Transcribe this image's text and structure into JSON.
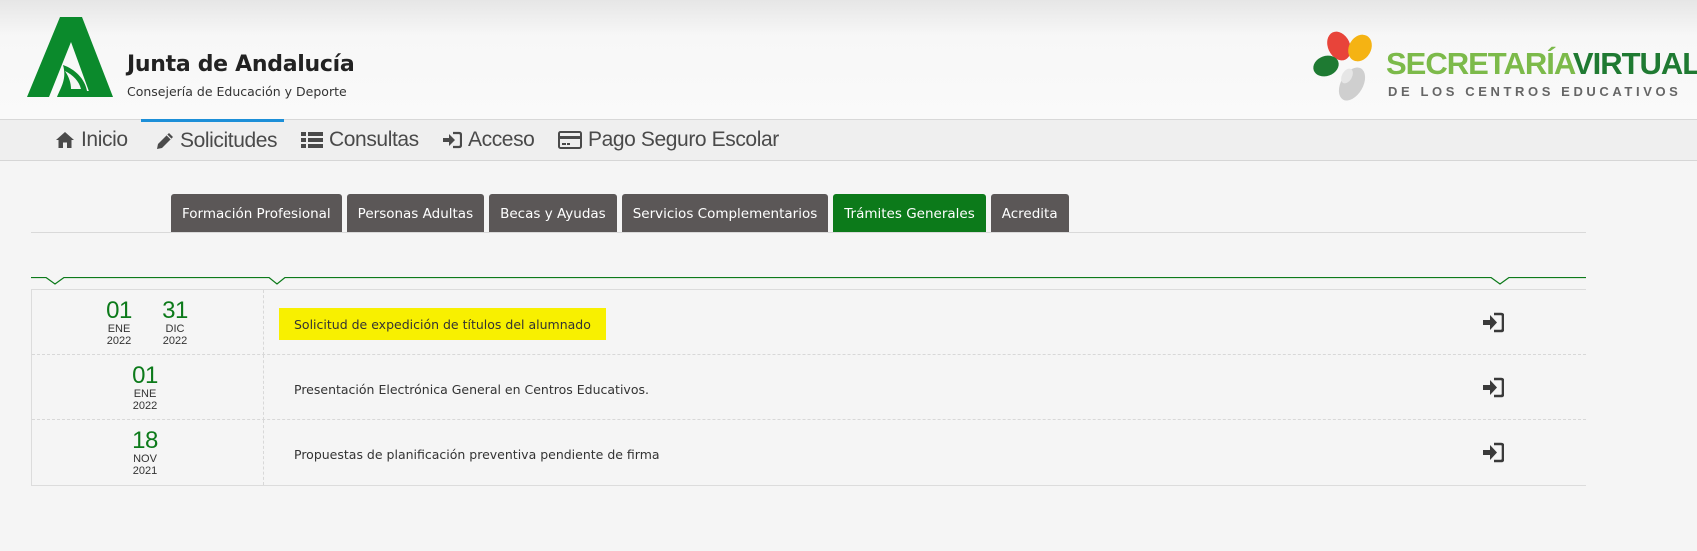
{
  "header": {
    "org_name": "Junta de Andalucía",
    "org_sub": "Consejería de Educación y Deporte",
    "sv_title_a": "SECRETARÍA",
    "sv_title_b": "VIRTUAL",
    "sv_sub": "DE LOS CENTROS EDUCATIVOS",
    "logo_icon": "junta-andalucia-logo",
    "sv_logo_icon": "secretaria-virtual-logo"
  },
  "nav": {
    "items": [
      {
        "label": "Inicio",
        "icon": "home-icon"
      },
      {
        "label": "Solicitudes",
        "icon": "pencil-icon"
      },
      {
        "label": "Consultas",
        "icon": "list-icon"
      },
      {
        "label": "Acceso",
        "icon": "sign-in-icon"
      },
      {
        "label": "Pago Seguro Escolar",
        "icon": "credit-card-icon"
      }
    ],
    "active_index": 1
  },
  "tabs": [
    {
      "label": "Formación Profesional"
    },
    {
      "label": "Personas Adultas"
    },
    {
      "label": "Becas y Ayudas"
    },
    {
      "label": "Servicios Complementarios"
    },
    {
      "label": "Trámites Generales"
    },
    {
      "label": "Acredita"
    }
  ],
  "active_tab": 4,
  "rows": [
    {
      "start": {
        "day": "01",
        "month": "ENE",
        "year": "2022"
      },
      "end": {
        "day": "31",
        "month": "DIC",
        "year": "2022"
      },
      "title": "Solicitud de expedición de títulos del alumnado",
      "highlighted": true
    },
    {
      "start": {
        "day": "01",
        "month": "ENE",
        "year": "2022"
      },
      "title": "Presentación Electrónica General en Centros Educativos.",
      "highlighted": false
    },
    {
      "start": {
        "day": "18",
        "month": "NOV",
        "year": "2021"
      },
      "title": "Propuestas de planificación preventiva pendiente de firma",
      "highlighted": false
    }
  ],
  "colors": {
    "brand_green": "#0c7a1a",
    "highlight": "#f8f000",
    "tab_bg": "#5b5757",
    "nav_active": "#1c8fd8"
  }
}
